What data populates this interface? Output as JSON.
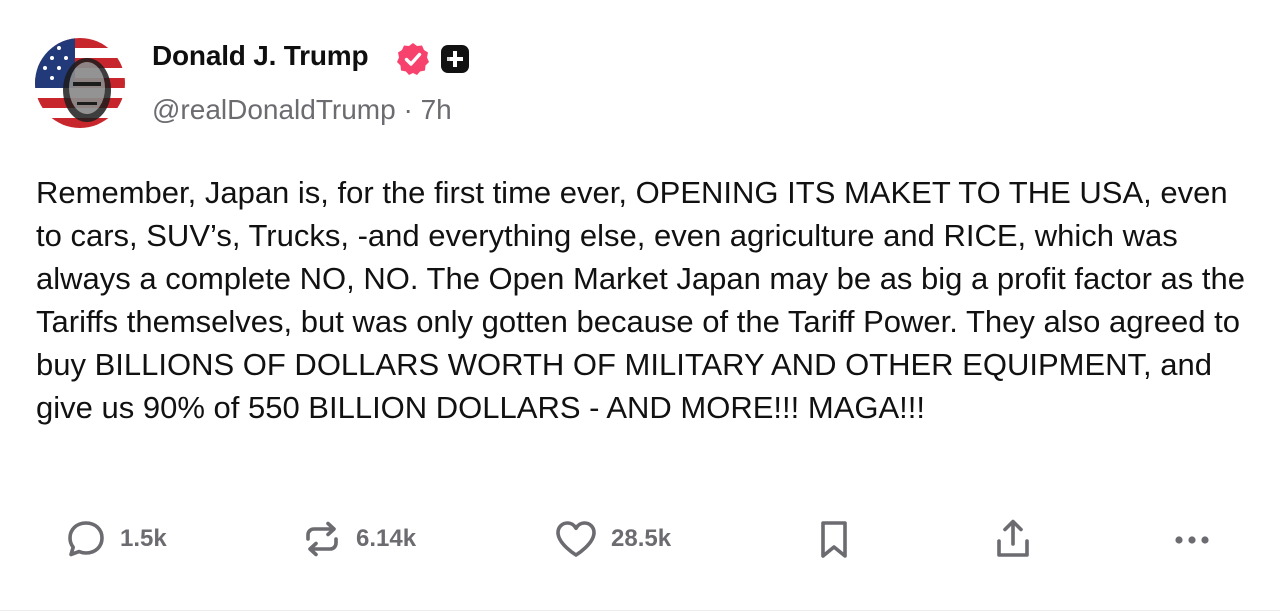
{
  "author": {
    "display_name": "Donald J. Trump",
    "handle": "@realDonaldTrump",
    "separator": "·",
    "time": "7h",
    "verified_icon": "verified-badge-icon",
    "badge_icon": "plus-badge-icon"
  },
  "post": {
    "text": "Remember, Japan is, for the first time ever, OPENING ITS MAKET TO THE USA, even to cars, SUV’s, Trucks, -and everything else, even agriculture and RICE, which was always a complete NO, NO. The Open Market Japan may be as big a profit factor as the Tariffs themselves, but was only gotten because of the Tariff Power. They also agreed to buy BILLIONS OF DOLLARS WORTH OF MILITARY AND OTHER EQUIPMENT, and give us 90% of 550 BILLION DOLLARS - AND MORE!!! MAGA!!!"
  },
  "actions": {
    "replies": "1.5k",
    "reposts": "6.14k",
    "likes": "28.5k",
    "bookmark_icon": "bookmark-icon",
    "share_icon": "share-icon",
    "more_icon": "more-options-icon"
  },
  "colors": {
    "verified": "#f6426d",
    "muted": "#6b6b70",
    "text": "#111111"
  }
}
